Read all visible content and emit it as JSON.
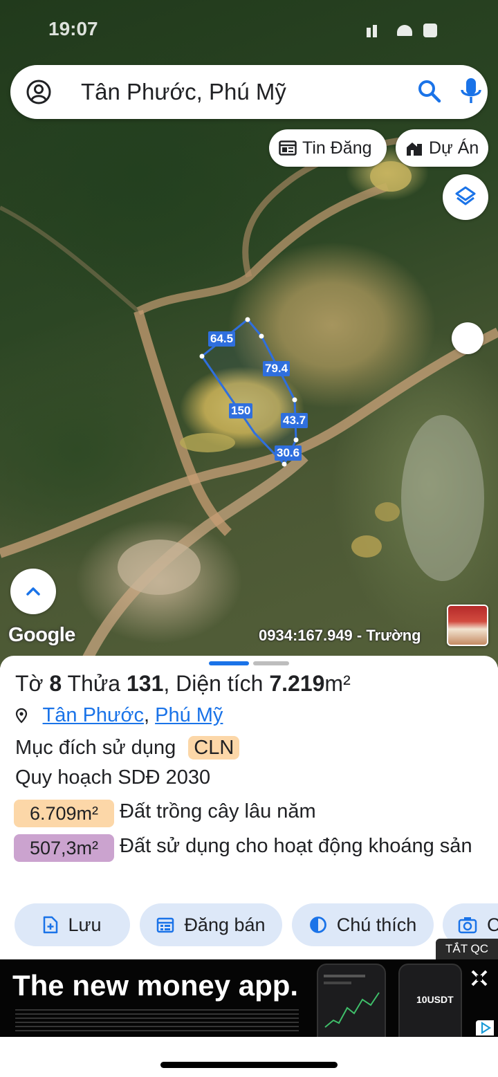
{
  "status_bar": {
    "time": "19:07"
  },
  "search": {
    "query": "Tân Phước, Phú Mỹ"
  },
  "map_chips": {
    "listing_label": "Tin Đăng",
    "project_label": "Dự Án"
  },
  "map": {
    "attribution": "Google",
    "contact": "0934:167.949 - Trường",
    "parcel_edges": [
      "64.5",
      "79.4",
      "150",
      "43.7",
      "30.6"
    ]
  },
  "sheet": {
    "title_prefix": "Tờ",
    "sheet_no": "8",
    "plot_label": "Thửa",
    "plot_no": "131",
    "area_label": ", Diện tích",
    "area_value": "7.219",
    "area_unit": "m²",
    "location_parts": [
      "Tân Phước",
      ", ",
      "Phú Mỹ"
    ],
    "purpose_label": "Mục đích sử dụng",
    "purpose_code": "CLN",
    "plan_label": "Quy hoạch SDĐ 2030",
    "zones": [
      {
        "area": "6.709m²",
        "description": "Đất trồng cây lâu năm",
        "color": "#fcd7a8"
      },
      {
        "area": "507,3m²",
        "description": "Đất sử dụng cho hoạt động khoáng sản",
        "color": "#cba3cf"
      }
    ],
    "actions": [
      "Lưu",
      "Đăng bán",
      "Chú thích",
      "C"
    ]
  },
  "ad": {
    "close_label": "TẮT QC",
    "headline": "The new money app.",
    "phone_text": "10USDT"
  },
  "colors": {
    "accent": "#1a73e8",
    "parcel_outline": "#2f6fde",
    "chip_bg": "#dde8f8"
  }
}
